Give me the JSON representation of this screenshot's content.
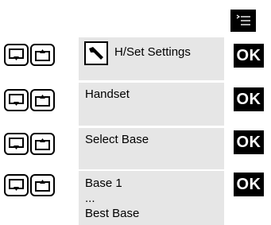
{
  "menu_key": {
    "icon": "menu-list-icon"
  },
  "ok_label": "OK",
  "rows": [
    {
      "text": "H/Set Settings",
      "icon": "wrench-icon"
    },
    {
      "text": "Handset"
    },
    {
      "text": "Select Base"
    },
    {
      "lines": [
        "Base 1",
        "...",
        "Best Base"
      ]
    }
  ],
  "nav_keys": {
    "down_icon": "navigate-down-icon",
    "up_icon": "navigate-up-icon"
  }
}
